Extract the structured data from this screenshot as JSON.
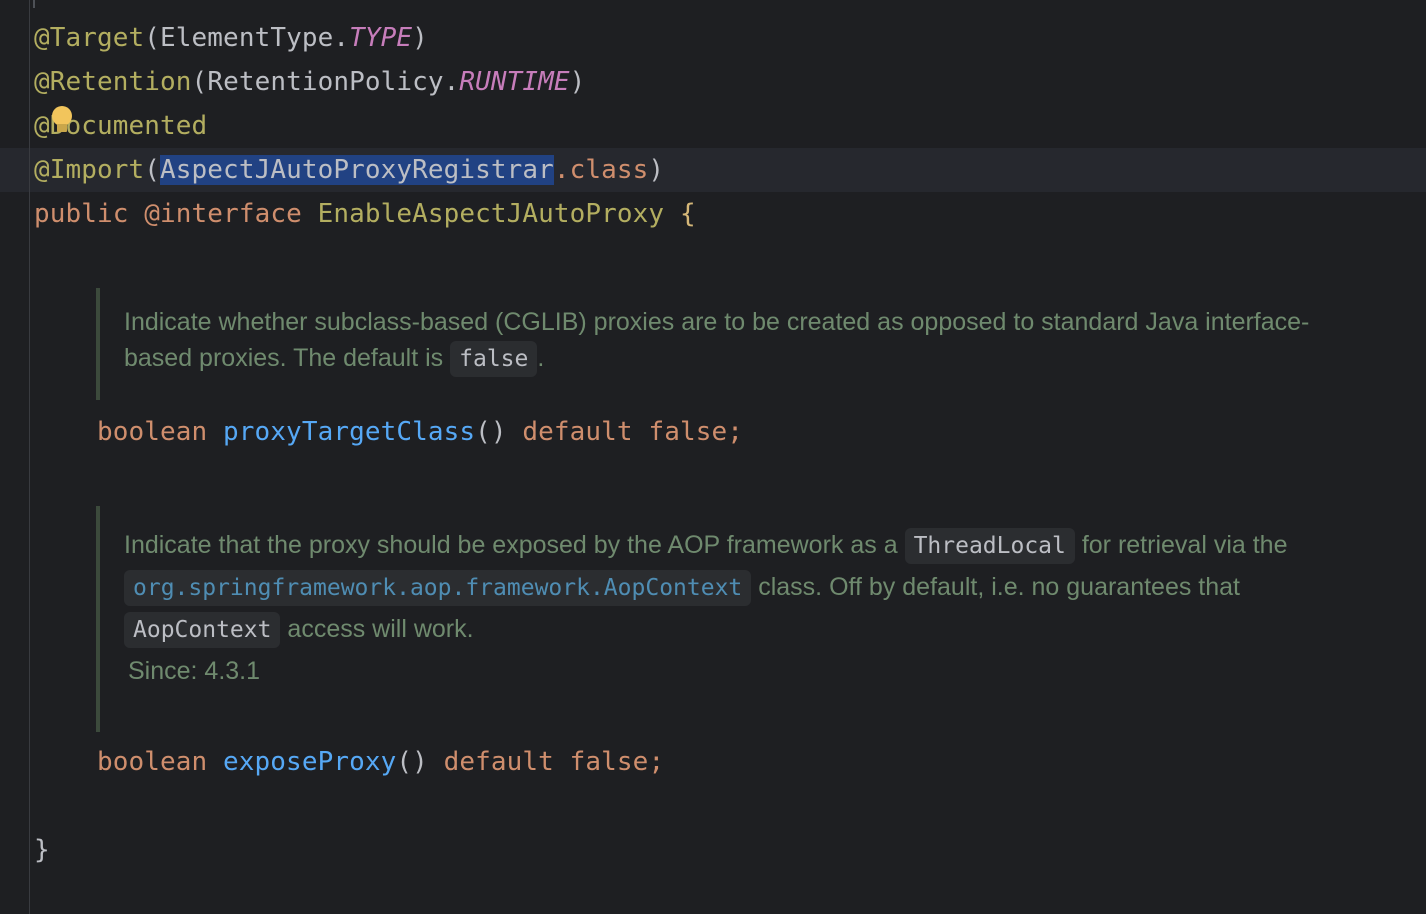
{
  "editor": {
    "lines": {
      "target": {
        "annotation": "@Target",
        "open": "(",
        "type": "ElementType.",
        "constant": "TYPE",
        "close": ")"
      },
      "retention": {
        "annotation": "@Retention",
        "open": "(",
        "type": "RetentionPolicy.",
        "constant": "RUNTIME",
        "close": ")"
      },
      "documented": {
        "annotation": "@Documented"
      },
      "import": {
        "annotation": "@Import",
        "open": "(",
        "selected_class": "AspectJAutoProxyRegistrar",
        "dot_class": ".class",
        "close": ")"
      },
      "declaration": {
        "public": "public",
        "interface_kw": "@interface",
        "name": "EnableAspectJAutoProxy",
        "brace": "{"
      },
      "method1": {
        "type": "boolean",
        "name": "proxyTargetClass",
        "parens": "()",
        "default_kw": "default",
        "value": "false",
        "semi": ";"
      },
      "method2": {
        "type": "boolean",
        "name": "exposeProxy",
        "parens": "()",
        "default_kw": "default",
        "value": "false",
        "semi": ";"
      },
      "closing": "}"
    },
    "doc1": {
      "text_before": "Indicate whether subclass-based (CGLIB) proxies are to be created as opposed to standard Java interface-based proxies. The default is ",
      "code": "false",
      "text_after": "."
    },
    "doc2": {
      "part1": "Indicate that the proxy should be exposed by the AOP framework as a ",
      "code1": "ThreadLocal",
      "part2": " for retrieval via the ",
      "link": "org.springframework.aop.framework.AopContext",
      "part3": " class. Off by default, i.e. no guarantees that ",
      "code2": "AopContext",
      "part4": " access will work.",
      "since": "Since: 4.3.1"
    }
  }
}
